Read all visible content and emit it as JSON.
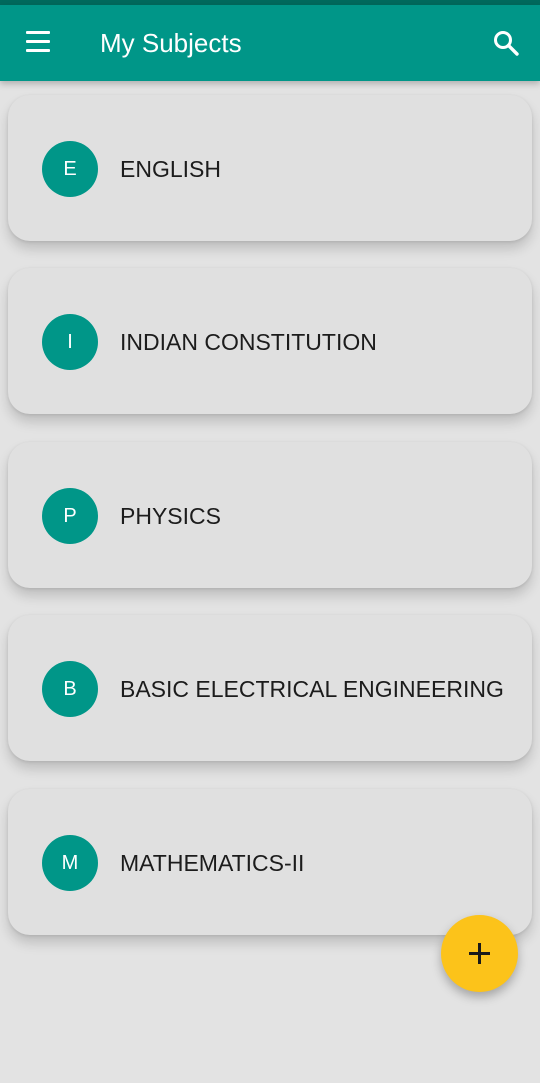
{
  "app_bar": {
    "title": "My Subjects",
    "menu_icon": "hamburger-menu-icon",
    "search_icon": "search-icon",
    "background_color": "#009688"
  },
  "subjects": [
    {
      "initial": "E",
      "name": "ENGLISH"
    },
    {
      "initial": "I",
      "name": "INDIAN CONSTITUTION"
    },
    {
      "initial": "P",
      "name": "PHYSICS"
    },
    {
      "initial": "B",
      "name": "BASIC ELECTRICAL ENGINEERING"
    },
    {
      "initial": "M",
      "name": "MATHEMATICS-II"
    }
  ],
  "fab": {
    "icon": "plus-icon",
    "color": "#fcc31a"
  },
  "colors": {
    "accent": "#009688",
    "status_bar": "#00695c",
    "card": "#e0e0e0",
    "background": "#e3e3e3"
  }
}
